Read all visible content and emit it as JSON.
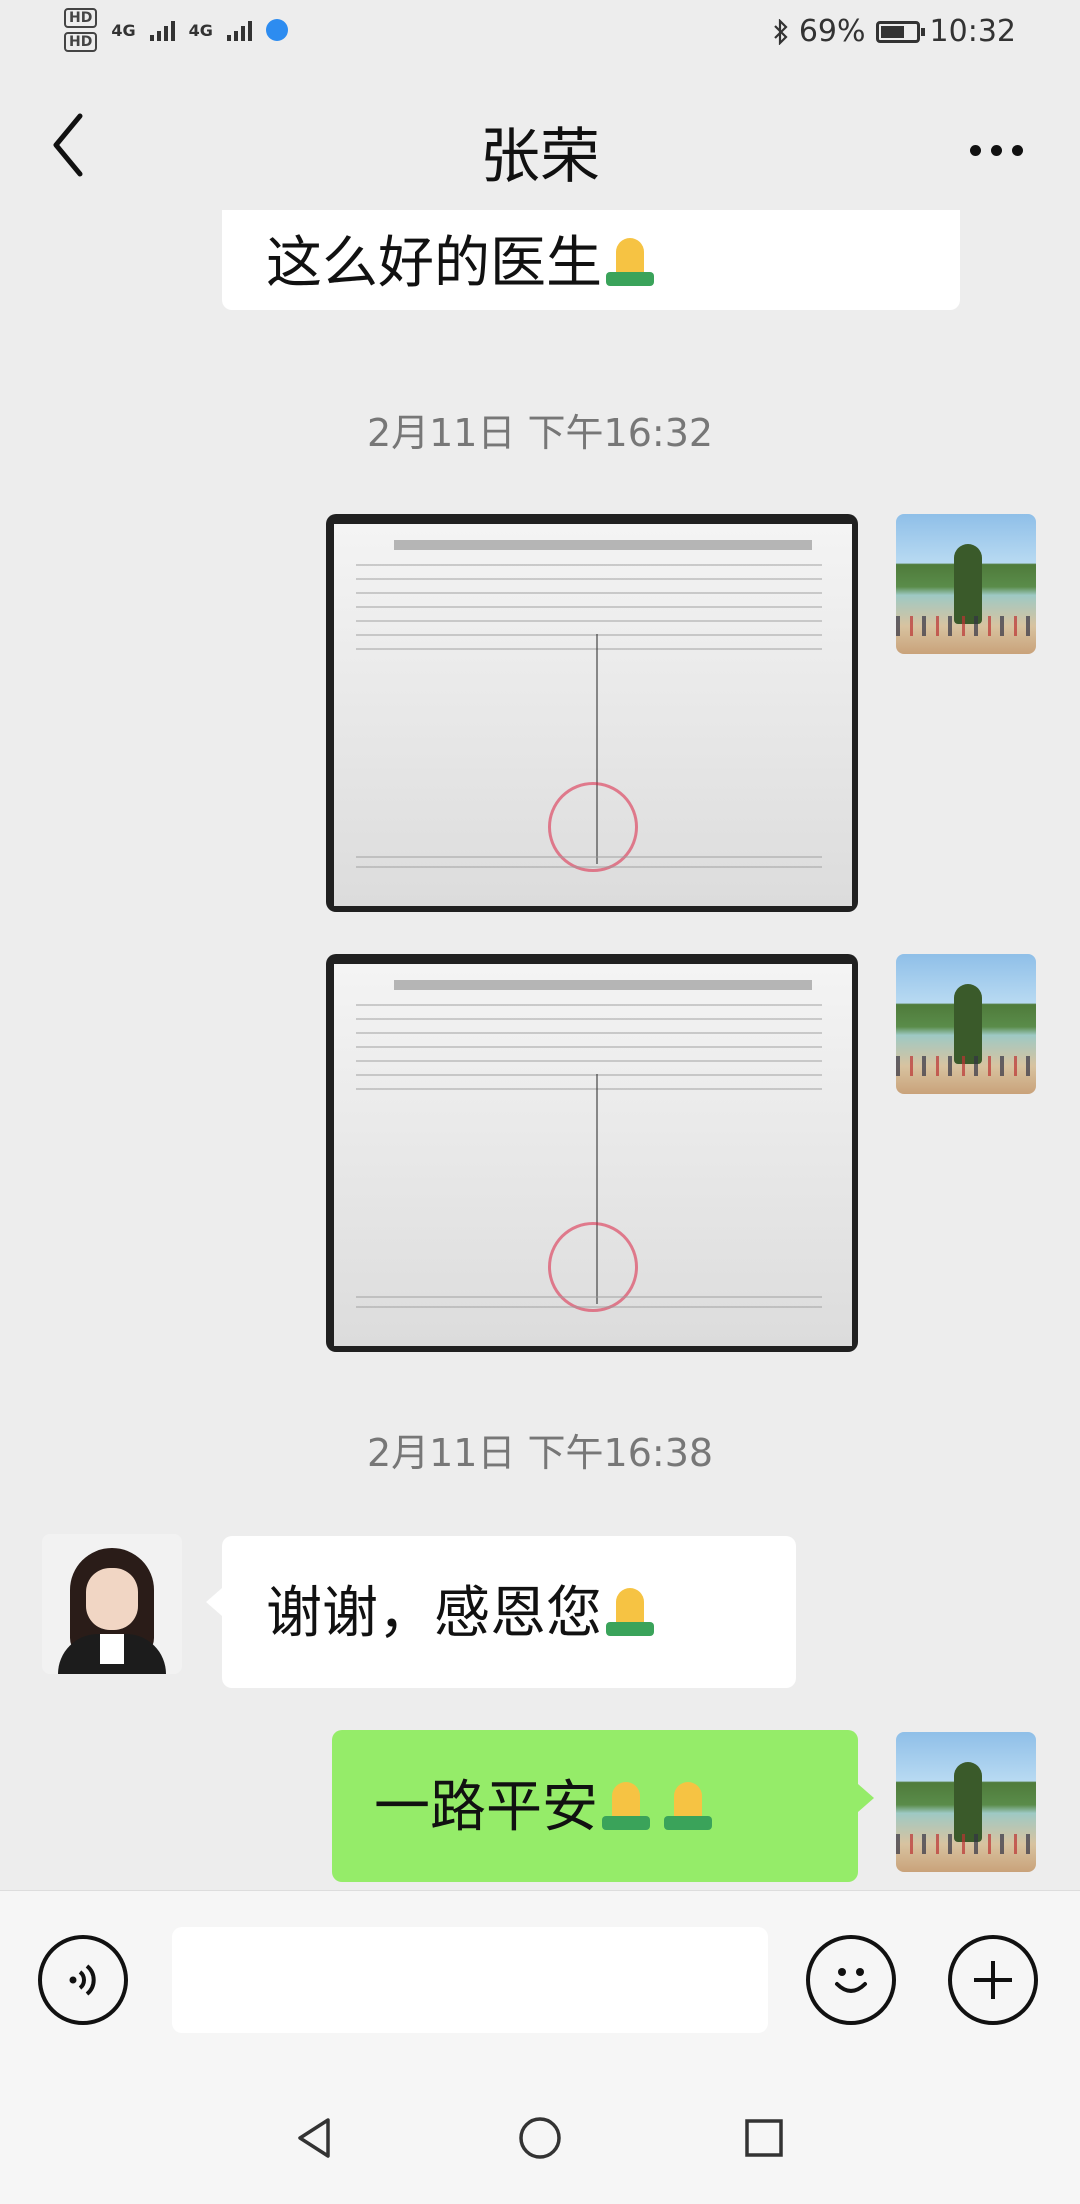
{
  "status": {
    "hd1": "HD",
    "hd2": "HD",
    "net1": "4G",
    "net2": "4G",
    "battery_text": "69%",
    "battery_level": 0.69,
    "time": "10:32"
  },
  "header": {
    "title": "张荣"
  },
  "messages": [
    {
      "type": "text",
      "side": "left",
      "text": "这么好的医生"
    },
    {
      "type": "timestamp",
      "text": "2月11日 下午16:32"
    },
    {
      "type": "image",
      "side": "right",
      "header_text": "太原市第四人民(结核病)医院检验报告单【门诊】"
    },
    {
      "type": "image",
      "side": "right",
      "header_text": "太原市第四人民(结核病)医院检验报告单【门诊】"
    },
    {
      "type": "timestamp",
      "text": "2月11日 下午16:38"
    },
    {
      "type": "text",
      "side": "left",
      "text": "谢谢，感恩您"
    },
    {
      "type": "text",
      "side": "right",
      "text": "一路平安"
    }
  ],
  "input": {
    "placeholder": ""
  },
  "icons": {
    "back": "chevron-left-icon",
    "more": "more-dots-icon",
    "voice": "voice-icon",
    "emoji": "smiley-icon",
    "plus": "plus-icon",
    "prayer": "folded-hands-emoji"
  },
  "colors": {
    "background": "#ededed",
    "bubble_self": "#95ec69",
    "bubble_other": "#ffffff",
    "timestamp": "#777777"
  }
}
